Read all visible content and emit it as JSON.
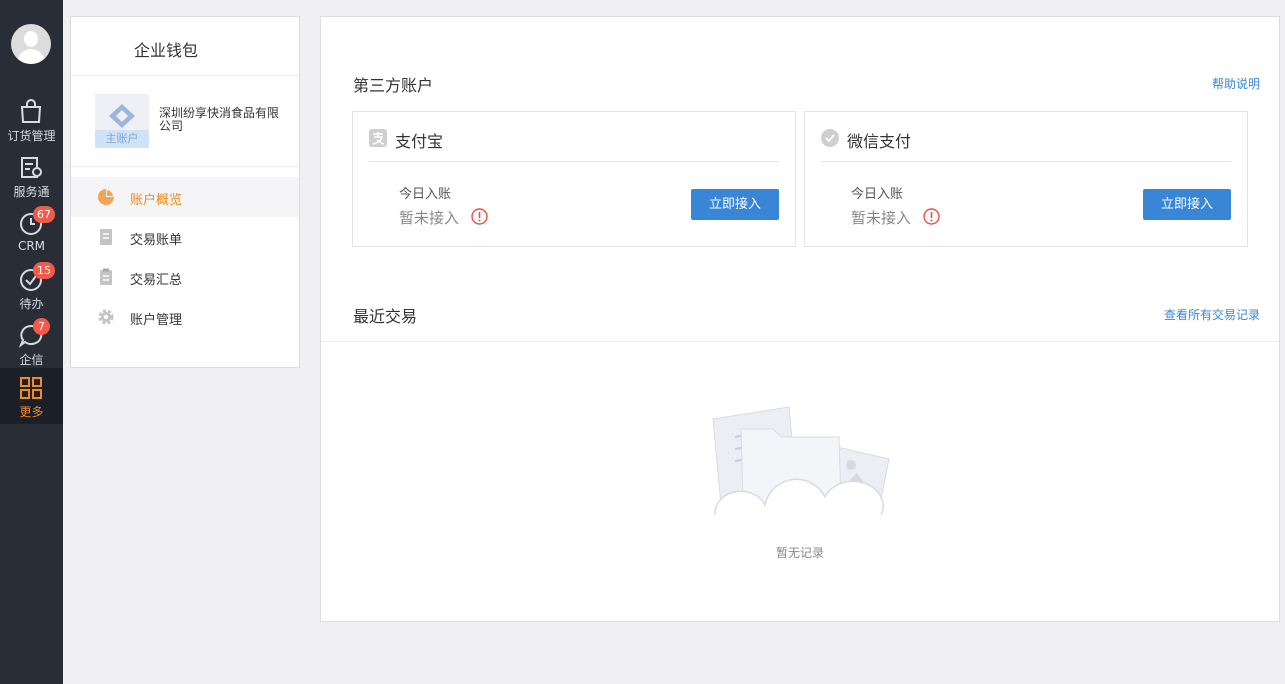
{
  "nav": {
    "items": [
      {
        "label": "订货管理",
        "icon": "shopping-bag-icon"
      },
      {
        "label": "服务通",
        "icon": "service-doc-icon"
      },
      {
        "label": "CRM",
        "icon": "clock-icon",
        "badge": "67"
      },
      {
        "label": "待办",
        "icon": "check-circle-icon",
        "badge": "15"
      },
      {
        "label": "企信",
        "icon": "chat-bubble-icon",
        "badge": "7"
      },
      {
        "label": "更多",
        "icon": "grid-icon"
      }
    ],
    "active_color": "#f08a24"
  },
  "wallet": {
    "title": "企业钱包",
    "company": {
      "name": "深圳纷享快消食品有限公司",
      "tag": "主账户"
    },
    "menu": [
      {
        "label": "账户概览",
        "icon": "pie-chart-icon",
        "active": true
      },
      {
        "label": "交易账单",
        "icon": "bill-icon"
      },
      {
        "label": "交易汇总",
        "icon": "clipboard-icon"
      },
      {
        "label": "账户管理",
        "icon": "gear-icon"
      }
    ]
  },
  "third_party": {
    "title": "第三方账户",
    "help_link": "帮助说明",
    "cards": [
      {
        "name": "支付宝",
        "today_label": "今日入账",
        "status": "暂未接入",
        "button": "立即接入"
      },
      {
        "name": "微信支付",
        "today_label": "今日入账",
        "status": "暂未接入",
        "button": "立即接入"
      }
    ]
  },
  "recent": {
    "title": "最近交易",
    "view_all_link": "查看所有交易记录",
    "empty_text": "暂无记录"
  },
  "colors": {
    "primary": "#3a86d6",
    "accent": "#f08a24",
    "badge": "#f25b4b",
    "warning": "#e8504a"
  }
}
